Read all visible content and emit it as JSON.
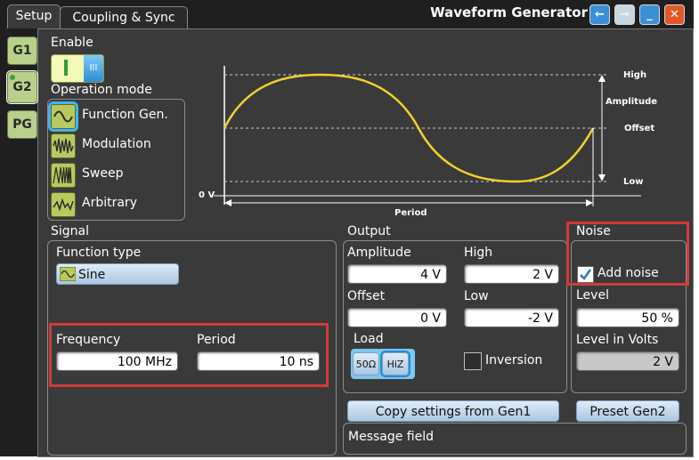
{
  "tabs": {
    "setup": "Setup",
    "coupling": "Coupling & Sync"
  },
  "window": {
    "title": "Waveform Generator"
  },
  "side_tabs": [
    "G1",
    "G2",
    "PG"
  ],
  "enable": {
    "label": "Enable",
    "state": "I"
  },
  "operation_mode": {
    "label": "Operation mode",
    "items": [
      "Function Gen.",
      "Modulation",
      "Sweep",
      "Arbitrary"
    ]
  },
  "diagram": {
    "high": "High",
    "amplitude": "Amplitude",
    "offset": "Offset",
    "low": "Low",
    "zero": "0 V",
    "period": "Period"
  },
  "signal": {
    "section": "Signal",
    "function_type_label": "Function type",
    "function_type_value": "Sine",
    "frequency_label": "Frequency",
    "frequency_value": "100 MHz",
    "period_label": "Period",
    "period_value": "10 ns"
  },
  "output": {
    "section": "Output",
    "amplitude_label": "Amplitude",
    "amplitude_value": "4 V",
    "high_label": "High",
    "high_value": "2 V",
    "offset_label": "Offset",
    "offset_value": "0 V",
    "low_label": "Low",
    "low_value": "-2 V",
    "load_label": "Load",
    "load_50": "50Ω",
    "load_hiz": "HiZ",
    "inversion_label": "Inversion"
  },
  "noise": {
    "section": "Noise",
    "add_noise_label": "Add noise",
    "add_noise_checked": true,
    "level_label": "Level",
    "level_value": "50 %",
    "level_volts_label": "Level in Volts",
    "level_volts_value": "2 V"
  },
  "buttons": {
    "copy": "Copy settings from Gen1",
    "preset": "Preset Gen2"
  },
  "message": {
    "label": "Message field"
  },
  "colors": {
    "accent": "#3fb4f0",
    "highlight": "#d23a3a",
    "wave": "#f2d12b",
    "green": "#b9c95e"
  }
}
